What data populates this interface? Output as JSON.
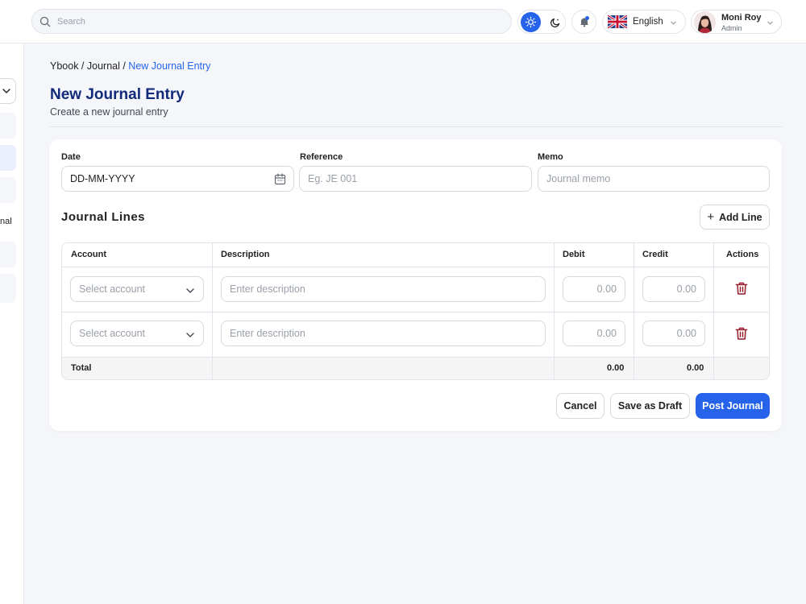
{
  "topbar": {
    "search_placeholder": "Search",
    "language": "English",
    "user_name": "Moni Roy",
    "user_role": "Admin"
  },
  "sidebar": {
    "partial_item_text": "nal"
  },
  "breadcrumb": {
    "items": [
      "Ybook",
      "Journal"
    ],
    "separator": " / ",
    "current": "New Journal Entry"
  },
  "page": {
    "title": "New Journal Entry",
    "subtitle": "Create a new journal entry"
  },
  "form": {
    "date_label": "Date",
    "date_value": "DD-MM-YYYY",
    "reference_label": "Reference",
    "reference_placeholder": "Eg. JE 001",
    "memo_label": "Memo",
    "memo_placeholder": "Journal memo"
  },
  "journal_lines": {
    "title": "Journal Lines",
    "add_line_label": "Add Line",
    "columns": {
      "account": "Account",
      "description": "Description",
      "debit": "Debit",
      "credit": "Credit",
      "actions": "Actions"
    },
    "rows": [
      {
        "account_placeholder": "Select account",
        "description_placeholder": "Enter description",
        "debit_placeholder": "0.00",
        "credit_placeholder": "0.00"
      },
      {
        "account_placeholder": "Select account",
        "description_placeholder": "Enter description",
        "debit_placeholder": "0.00",
        "credit_placeholder": "0.00"
      }
    ],
    "total_label": "Total",
    "total_debit": "0.00",
    "total_credit": "0.00"
  },
  "actions": {
    "cancel": "Cancel",
    "save_draft": "Save as Draft",
    "post": "Post Journal"
  },
  "colors": {
    "primary": "#2563eb",
    "title": "#112a7a",
    "danger": "#9b1c2e"
  }
}
